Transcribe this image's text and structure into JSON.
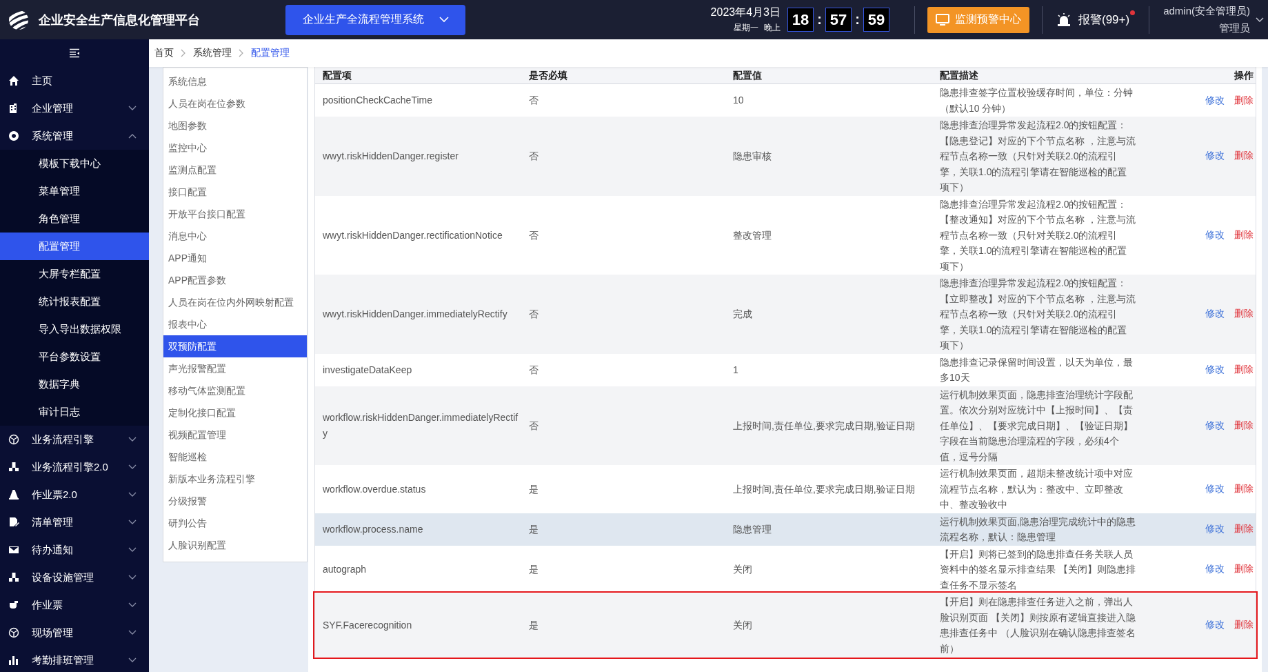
{
  "header": {
    "title": "企业安全生产信息化管理平台",
    "system_switch": "企业生产全流程管理系统",
    "date": "2023年4月3日",
    "weekday": "星期一",
    "period": "晚上",
    "clock": [
      {
        "kind": "digits",
        "text": "18"
      },
      {
        "kind": "separator",
        "text": ":"
      },
      {
        "kind": "digits",
        "text": "57"
      },
      {
        "kind": "separator",
        "text": ":"
      },
      {
        "kind": "digits",
        "text": "59"
      }
    ],
    "monitor_button": "监测预警中心",
    "alarm": {
      "label": "报警(99+)",
      "unread": true
    },
    "user": {
      "name": "admin(安全管理员)",
      "role": "管理员"
    }
  },
  "sidebar": {
    "items": [
      {
        "label": "主页",
        "kind": "link"
      },
      {
        "label": "企业管理",
        "kind": "group",
        "expanded": false
      },
      {
        "label": "系统管理",
        "kind": "group",
        "expanded": true,
        "children": [
          {
            "label": "模板下载中心",
            "selected": false
          },
          {
            "label": "菜单管理",
            "selected": false
          },
          {
            "label": "角色管理",
            "selected": false
          },
          {
            "label": "配置管理",
            "selected": true
          },
          {
            "label": "大屏专栏配置",
            "selected": false
          },
          {
            "label": "统计报表配置",
            "selected": false
          },
          {
            "label": "导入导出数据权限",
            "selected": false
          },
          {
            "label": "平台参数设置",
            "selected": false
          },
          {
            "label": "数据字典",
            "selected": false
          },
          {
            "label": "审计日志",
            "selected": false
          }
        ]
      },
      {
        "label": "业务流程引擎",
        "kind": "group",
        "expanded": false
      },
      {
        "label": "业务流程引擎2.0",
        "kind": "group",
        "expanded": false
      },
      {
        "label": "作业票2.0",
        "kind": "group",
        "expanded": false
      },
      {
        "label": "清单管理",
        "kind": "group",
        "expanded": false
      },
      {
        "label": "待办通知",
        "kind": "group",
        "expanded": false
      },
      {
        "label": "设备设施管理",
        "kind": "group",
        "expanded": false
      },
      {
        "label": "作业票",
        "kind": "group",
        "expanded": false
      },
      {
        "label": "现场管理",
        "kind": "group",
        "expanded": false
      },
      {
        "label": "考勤排班管理",
        "kind": "group",
        "expanded": false
      }
    ]
  },
  "breadcrumb": [
    {
      "label": "首页",
      "current": false
    },
    {
      "label": "系统管理",
      "current": false
    },
    {
      "label": "配置管理",
      "current": true
    }
  ],
  "config_nav": {
    "items": [
      {
        "label": "系统信息",
        "selected": false
      },
      {
        "label": "人员在岗在位参数",
        "selected": false
      },
      {
        "label": "地图参数",
        "selected": false
      },
      {
        "label": "监控中心",
        "selected": false
      },
      {
        "label": "监测点配置",
        "selected": false
      },
      {
        "label": "接口配置",
        "selected": false
      },
      {
        "label": "开放平台接口配置",
        "selected": false
      },
      {
        "label": "消息中心",
        "selected": false
      },
      {
        "label": "APP通知",
        "selected": false
      },
      {
        "label": "APP配置参数",
        "selected": false
      },
      {
        "label": "人员在岗在位内外网映射配置",
        "selected": false
      },
      {
        "label": "报表中心",
        "selected": false
      },
      {
        "label": "双预防配置",
        "selected": true
      },
      {
        "label": "声光报警配置",
        "selected": false
      },
      {
        "label": "移动气体监测配置",
        "selected": false
      },
      {
        "label": "定制化接口配置",
        "selected": false
      },
      {
        "label": "视频配置管理",
        "selected": false
      },
      {
        "label": "智能巡检",
        "selected": false
      },
      {
        "label": "新版本业务流程引擎",
        "selected": false
      },
      {
        "label": "分级报警",
        "selected": false
      },
      {
        "label": "研判公告",
        "selected": false
      },
      {
        "label": "人脸识别配置",
        "selected": false
      }
    ]
  },
  "table": {
    "columns": [
      "配置项",
      "是否必填",
      "配置值",
      "配置描述",
      "操作"
    ],
    "rows": [
      {
        "key": "positionCheckCacheTime",
        "required": "否",
        "value": "10",
        "description": "隐患排查签字位置校验缓存时间，单位：分钟（默认10 分钟）",
        "actions": [
          {
            "kind": "edit",
            "label": "修改"
          },
          {
            "kind": "delete",
            "label": "删除"
          }
        ],
        "hovered": false,
        "highlighted": false
      },
      {
        "key": "wwyt.riskHiddenDanger.register",
        "required": "否",
        "value": "隐患审核",
        "description": "隐患排查治理异常发起流程2.0的按钮配置：【隐患登记】对应的下个节点名称 ，注意与流程节点名称一致（只针对关联2.0的流程引擎，关联1.0的流程引擎请在智能巡检的配置项下）",
        "actions": [
          {
            "kind": "edit",
            "label": "修改"
          },
          {
            "kind": "delete",
            "label": "删除"
          }
        ],
        "hovered": false,
        "highlighted": false
      },
      {
        "key": "wwyt.riskHiddenDanger.rectificationNotice",
        "required": "否",
        "value": "整改管理",
        "description": "隐患排查治理异常发起流程2.0的按钮配置：【整改通知】对应的下个节点名称 ，注意与流程节点名称一致（只针对关联2.0的流程引擎，关联1.0的流程引擎请在智能巡检的配置项下）",
        "actions": [
          {
            "kind": "edit",
            "label": "修改"
          },
          {
            "kind": "delete",
            "label": "删除"
          }
        ],
        "hovered": false,
        "highlighted": false
      },
      {
        "key": "wwyt.riskHiddenDanger.immediatelyRectify",
        "required": "否",
        "value": "完成",
        "description": "隐患排查治理异常发起流程2.0的按钮配置：【立即整改】对应的下个节点名称 ，注意与流程节点名称一致（只针对关联2.0的流程引擎，关联1.0的流程引擎请在智能巡检的配置项下）",
        "actions": [
          {
            "kind": "edit",
            "label": "修改"
          },
          {
            "kind": "delete",
            "label": "删除"
          }
        ],
        "hovered": false,
        "highlighted": false
      },
      {
        "key": "investigateDataKeep",
        "required": "否",
        "value": "1",
        "description": "隐患排查记录保留时间设置，以天为单位，最多10天",
        "actions": [
          {
            "kind": "edit",
            "label": "修改"
          },
          {
            "kind": "delete",
            "label": "删除"
          }
        ],
        "hovered": false,
        "highlighted": false
      },
      {
        "key": "workflow.riskHiddenDanger.immediatelyRectify",
        "required": "否",
        "value": "上报时间,责任单位,要求完成日期,验证日期",
        "description": "运行机制效果页面，隐患排查治理统计字段配置。依次分别对应统计中【上报时间】、【责任单位】、【要求完成日期】、【验证日期】字段在当前隐患治理流程的字段，必须4个值，逗号分隔",
        "actions": [
          {
            "kind": "edit",
            "label": "修改"
          },
          {
            "kind": "delete",
            "label": "删除"
          }
        ],
        "hovered": false,
        "highlighted": false
      },
      {
        "key": "workflow.overdue.status",
        "required": "是",
        "value": "上报时间,责任单位,要求完成日期,验证日期",
        "description": "运行机制效果页面，超期未整改统计项中对应流程节点名称，默认为：整改中、立即整改中、整改验收中",
        "actions": [
          {
            "kind": "edit",
            "label": "修改"
          },
          {
            "kind": "delete",
            "label": "删除"
          }
        ],
        "hovered": false,
        "highlighted": false
      },
      {
        "key": "workflow.process.name",
        "required": "是",
        "value": "隐患管理",
        "description": "运行机制效果页面,隐患治理完成统计中的隐患流程名称，默认：隐患管理",
        "actions": [
          {
            "kind": "edit",
            "label": "修改"
          },
          {
            "kind": "delete",
            "label": "删除"
          }
        ],
        "hovered": true,
        "highlighted": false
      },
      {
        "key": "autograph",
        "required": "是",
        "value": "关闭",
        "description": "【开启】则将已签到的隐患排查任务关联人员资料中的签名显示排查结果 【关闭】则隐患排查任务不显示签名",
        "actions": [
          {
            "kind": "edit",
            "label": "修改"
          },
          {
            "kind": "delete",
            "label": "删除"
          }
        ],
        "hovered": false,
        "highlighted": false
      },
      {
        "key": "SYF.Facerecognition",
        "required": "是",
        "value": "关闭",
        "description": "【开启】则在隐患排查任务进入之前，弹出人脸识别页面 【关闭】则按原有逻辑直接进入隐患排查任务中 （人脸识别在确认隐患排查签名前）",
        "actions": [
          {
            "kind": "edit",
            "label": "修改"
          },
          {
            "kind": "delete",
            "label": "删除"
          }
        ],
        "hovered": false,
        "highlighted": true
      }
    ]
  }
}
